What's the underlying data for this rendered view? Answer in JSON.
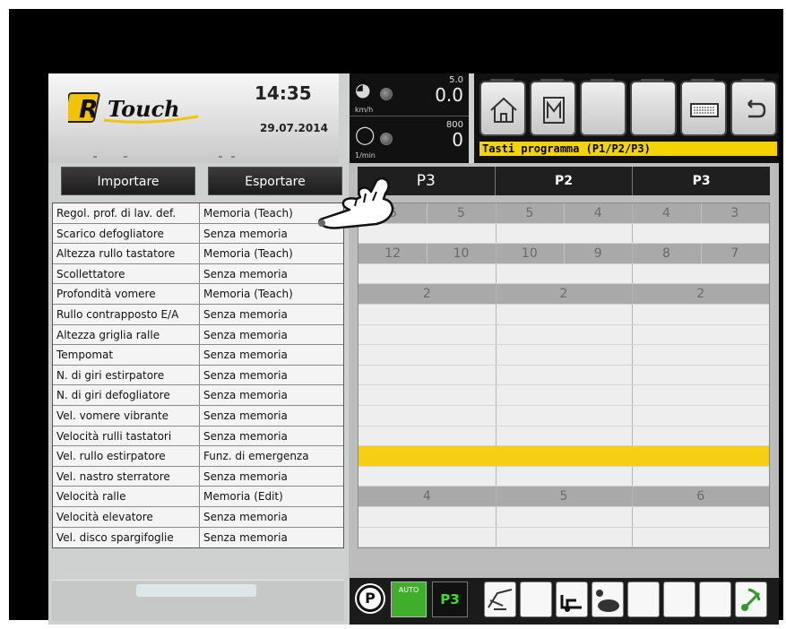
{
  "header": {
    "brand_logo_text": "R Touch",
    "clock": "14:35",
    "date": "29.07.2014"
  },
  "gauges": {
    "speed": {
      "max": "5.0",
      "value": "0.0",
      "unit": "km/h"
    },
    "rpm": {
      "max": "800",
      "value": "0",
      "unit": "1/min"
    }
  },
  "toolbar": {
    "buttons": [
      "home-icon",
      "memory-icon",
      "blank",
      "blank",
      "keyboard-icon",
      "back-icon"
    ],
    "program_label": "Tasti programma (P1/P2/P3)"
  },
  "actions": {
    "import_label": "Importare",
    "export_label": "Esportare"
  },
  "program_tabs": [
    "P3",
    "P2",
    "P3"
  ],
  "table": [
    {
      "name": "Regol. prof. di lav. def.",
      "mode": "Memoria (Teach)",
      "style": "grey",
      "cells": [
        "6",
        "5",
        "5",
        "4",
        "4",
        "3"
      ]
    },
    {
      "name": "Scarico defogliatore",
      "mode": "Senza memoria",
      "style": "",
      "cells": []
    },
    {
      "name": "Altezza rullo tastatore",
      "mode": "Memoria (Teach)",
      "style": "grey",
      "cells": [
        "12",
        "10",
        "10",
        "9",
        "8",
        "7"
      ]
    },
    {
      "name": "Scollettatore",
      "mode": "Senza memoria",
      "style": "",
      "cells": []
    },
    {
      "name": "Profondità vomere",
      "mode": "Memoria (Teach)",
      "style": "grey",
      "cells": [
        "2",
        "2",
        "2"
      ]
    },
    {
      "name": "Rullo contrapposto E/A",
      "mode": "Senza memoria",
      "style": "",
      "cells": []
    },
    {
      "name": "Altezza griglia ralle",
      "mode": "Senza memoria",
      "style": "",
      "cells": []
    },
    {
      "name": "Tempomat",
      "mode": "Senza memoria",
      "style": "",
      "cells": []
    },
    {
      "name": "N. di giri estirpatore",
      "mode": "Senza memoria",
      "style": "",
      "cells": []
    },
    {
      "name": "N. di giri defogliatore",
      "mode": "Senza memoria",
      "style": "",
      "cells": []
    },
    {
      "name": "Vel. vomere vibrante",
      "mode": "Senza memoria",
      "style": "",
      "cells": []
    },
    {
      "name": "Velocità rulli tastatori",
      "mode": "Senza memoria",
      "style": "",
      "cells": []
    },
    {
      "name": "Vel. rullo estirpatore",
      "mode": "Funz. di emergenza",
      "style": "yellow",
      "cells": []
    },
    {
      "name": "Vel. nastro sterratore",
      "mode": "Senza memoria",
      "style": "",
      "cells": []
    },
    {
      "name": "Velocità ralle",
      "mode": "Memoria (Edit)",
      "style": "grey",
      "cells": [
        "4",
        "5",
        "6"
      ]
    },
    {
      "name": "Velocità elevatore",
      "mode": "Senza memoria",
      "style": "",
      "cells": []
    },
    {
      "name": "Vel. disco spargifoglie",
      "mode": "Senza memoria",
      "style": "",
      "cells": []
    }
  ],
  "status_bar": {
    "parking_label": "P",
    "auto_label": "AUTO",
    "program_badge": "P3"
  },
  "colors": {
    "accent_yellow": "#f6cf12",
    "auto_green": "#3fae2a",
    "dark": "#1b1b1b"
  }
}
